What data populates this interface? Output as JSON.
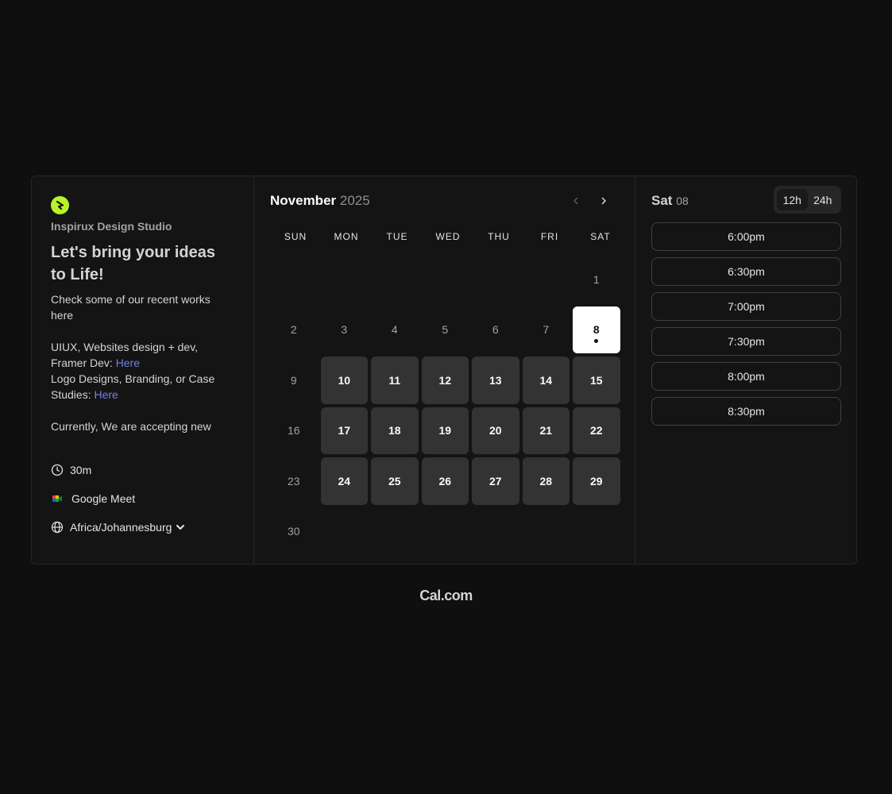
{
  "profile": {
    "org_name": "Inspirux Design Studio",
    "headline": "Let's bring your ideas to Life!",
    "desc_line1": "Check some of our recent works here",
    "desc_line2a": "UIUX, Websites design + dev, Framer Dev: ",
    "desc_link1": "Here",
    "desc_line3a": "Logo Designs, Branding, or Case Studies: ",
    "desc_link2": "Here",
    "desc_line4": "Currently, We are accepting new",
    "duration": "30m",
    "location": "Google Meet",
    "timezone": "Africa/Johannesburg"
  },
  "calendar": {
    "month": "November",
    "year": "2025",
    "weekdays": [
      "SUN",
      "MON",
      "TUE",
      "WED",
      "THU",
      "FRI",
      "SAT"
    ],
    "leading_blanks": 6,
    "days": [
      {
        "n": "1",
        "state": "off"
      },
      {
        "n": "2",
        "state": "off"
      },
      {
        "n": "3",
        "state": "off"
      },
      {
        "n": "4",
        "state": "off"
      },
      {
        "n": "5",
        "state": "off"
      },
      {
        "n": "6",
        "state": "off"
      },
      {
        "n": "7",
        "state": "off"
      },
      {
        "n": "8",
        "state": "selected"
      },
      {
        "n": "9",
        "state": "off"
      },
      {
        "n": "10",
        "state": "avail"
      },
      {
        "n": "11",
        "state": "avail"
      },
      {
        "n": "12",
        "state": "avail"
      },
      {
        "n": "13",
        "state": "avail"
      },
      {
        "n": "14",
        "state": "avail"
      },
      {
        "n": "15",
        "state": "avail"
      },
      {
        "n": "16",
        "state": "off"
      },
      {
        "n": "17",
        "state": "avail"
      },
      {
        "n": "18",
        "state": "avail"
      },
      {
        "n": "19",
        "state": "avail"
      },
      {
        "n": "20",
        "state": "avail"
      },
      {
        "n": "21",
        "state": "avail"
      },
      {
        "n": "22",
        "state": "avail"
      },
      {
        "n": "23",
        "state": "off"
      },
      {
        "n": "24",
        "state": "avail"
      },
      {
        "n": "25",
        "state": "avail"
      },
      {
        "n": "26",
        "state": "avail"
      },
      {
        "n": "27",
        "state": "avail"
      },
      {
        "n": "28",
        "state": "avail"
      },
      {
        "n": "29",
        "state": "avail"
      },
      {
        "n": "30",
        "state": "off"
      }
    ]
  },
  "slots": {
    "day_name": "Sat",
    "day_num": "08",
    "format_12h": "12h",
    "format_24h": "24h",
    "times": [
      "6:00pm",
      "6:30pm",
      "7:00pm",
      "7:30pm",
      "8:00pm",
      "8:30pm"
    ]
  },
  "footer": {
    "brand": "Cal.com"
  },
  "colors": {
    "accent_logo": "#b9f227",
    "link": "#7180e8",
    "available_day": "#333333",
    "selected_day": "#ffffff"
  }
}
